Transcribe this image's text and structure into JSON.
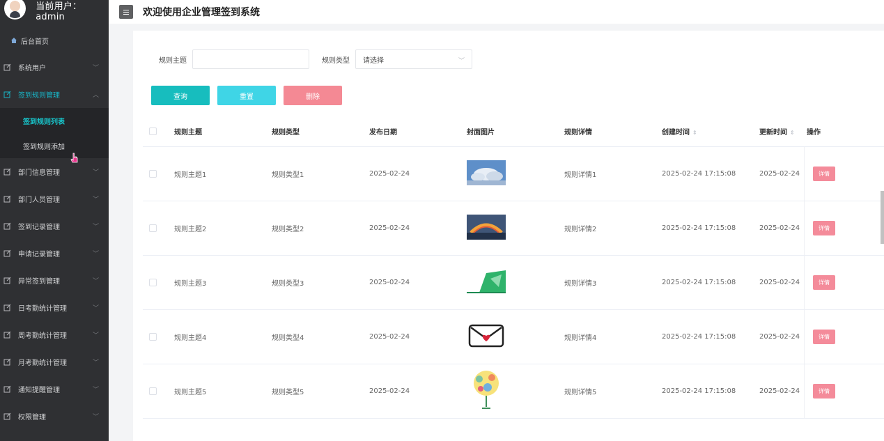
{
  "header": {
    "title": "欢迎使用企业管理签到系统",
    "menu_toggle": "toggle-sidebar"
  },
  "user": {
    "label": "当前用户：admin"
  },
  "sidebar": {
    "home": "后台首页",
    "items": [
      {
        "label": "系统用户"
      },
      {
        "label": "签到规则管理",
        "expanded": true,
        "children": [
          {
            "label": "签到规则列表",
            "active": true
          },
          {
            "label": "签到规则添加"
          }
        ]
      },
      {
        "label": "部门信息管理"
      },
      {
        "label": "部门人员管理"
      },
      {
        "label": "签到记录管理"
      },
      {
        "label": "申请记录管理"
      },
      {
        "label": "异常签到管理"
      },
      {
        "label": "日考勤统计管理"
      },
      {
        "label": "周考勤统计管理"
      },
      {
        "label": "月考勤统计管理"
      },
      {
        "label": "通知提醒管理"
      },
      {
        "label": "权限管理"
      }
    ]
  },
  "filters": {
    "topic_label": "规则主题",
    "topic_value": "",
    "type_label": "规则类型",
    "type_placeholder": "请选择"
  },
  "actions": {
    "query": "查询",
    "reset": "重置",
    "delete": "删除"
  },
  "table": {
    "columns": {
      "topic": "规则主题",
      "type": "规则类型",
      "date": "发布日期",
      "image": "封面图片",
      "detail": "规则详情",
      "created": "创建时间",
      "updated": "更新时间",
      "op": "操作"
    },
    "rows": [
      {
        "topic": "规则主题1",
        "type": "规则类型1",
        "date": "2025-02-24",
        "image": "sky-clouds-image",
        "detail": "规则详情1",
        "created": "2025-02-24 17:15:08",
        "updated": "2025-02-24",
        "action": "详情"
      },
      {
        "topic": "规则主题2",
        "type": "规则类型2",
        "date": "2025-02-24",
        "image": "sunset-rainbow-image",
        "detail": "规则详情2",
        "created": "2025-02-24 17:15:08",
        "updated": "2025-02-24",
        "action": "详情"
      },
      {
        "topic": "规则主题3",
        "type": "规则类型3",
        "date": "2025-02-24",
        "image": "green-logo-image",
        "detail": "规则详情3",
        "created": "2025-02-24 17:15:08",
        "updated": "2025-02-24",
        "action": "详情"
      },
      {
        "topic": "规则主题4",
        "type": "规则类型4",
        "date": "2025-02-24",
        "image": "envelope-heart-image",
        "detail": "规则详情4",
        "created": "2025-02-24 17:15:08",
        "updated": "2025-02-24",
        "action": "详情"
      },
      {
        "topic": "规则主题5",
        "type": "规则类型5",
        "date": "2025-02-24",
        "image": "balloon-tree-image",
        "detail": "规则详情5",
        "created": "2025-02-24 17:15:08",
        "updated": "2025-02-24",
        "action": "详情"
      }
    ]
  },
  "colors": {
    "sidebar_bg": "#2f3033",
    "accent": "#17bdbe",
    "danger": "#f48994"
  }
}
